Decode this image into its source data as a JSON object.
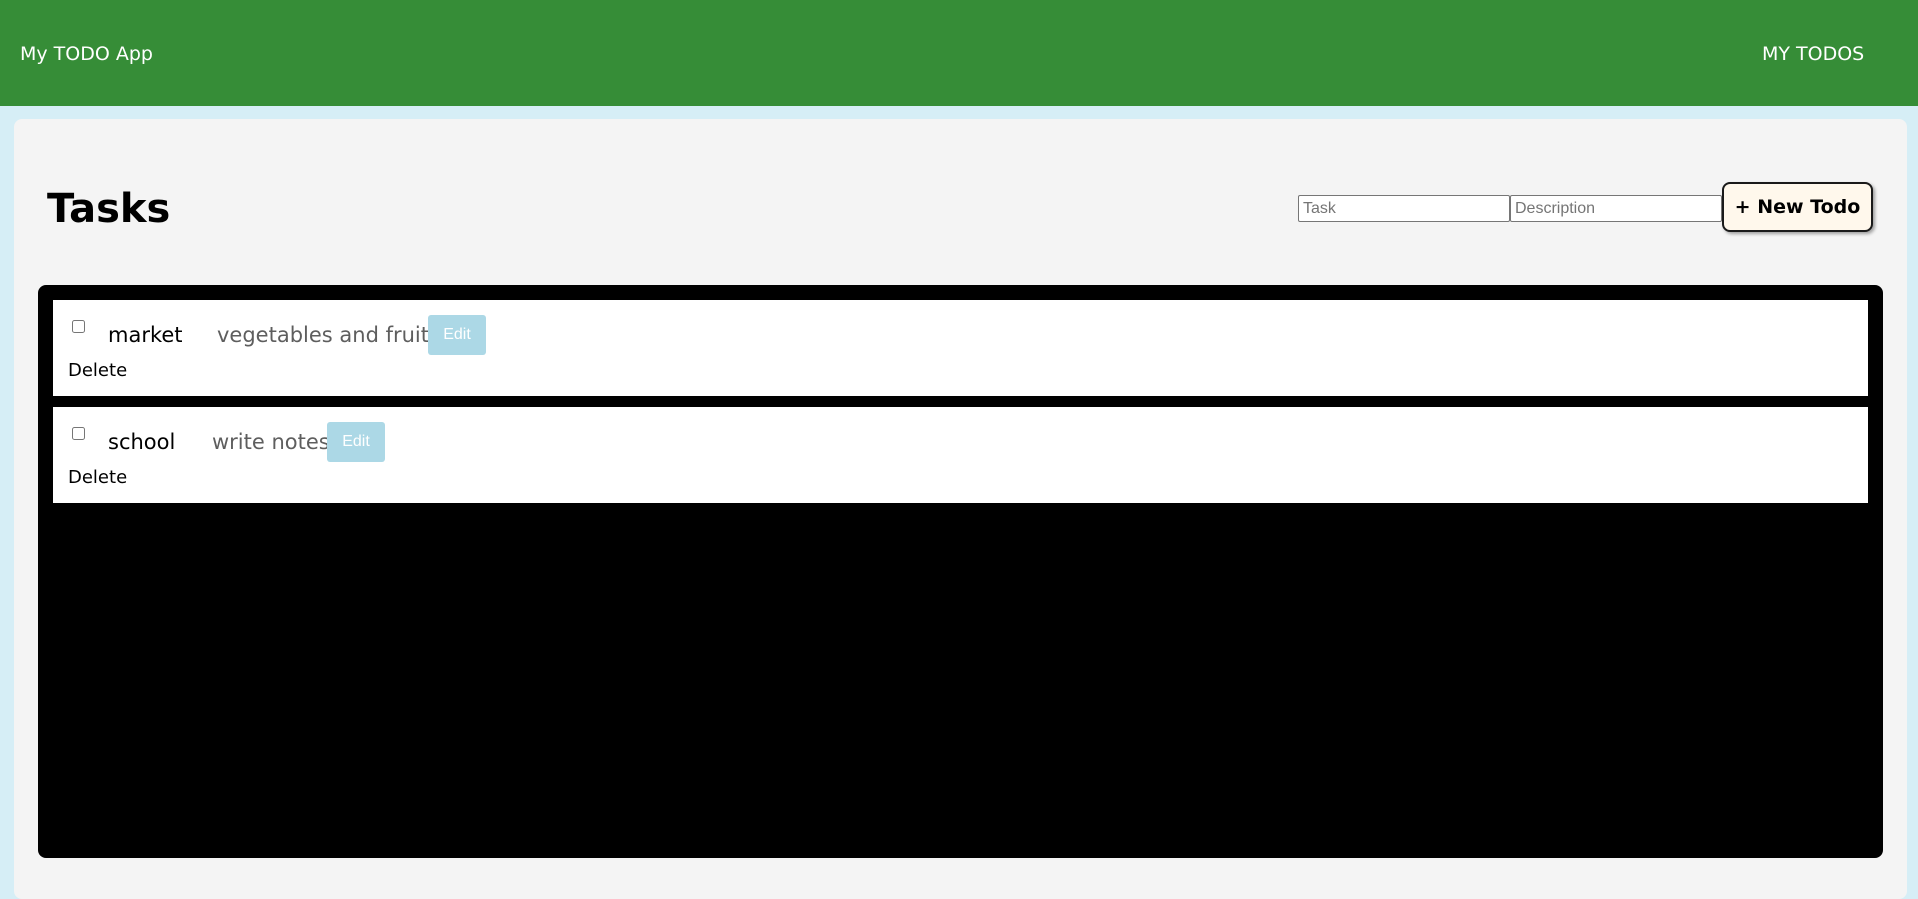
{
  "navbar": {
    "brand": "My TODO App",
    "link": "MY TODOS",
    "color": "#368d37"
  },
  "page": {
    "title": "Tasks"
  },
  "form": {
    "task_placeholder": "Task",
    "description_placeholder": "Description",
    "new_button": "+ New Todo"
  },
  "todos": [
    {
      "title": "market",
      "description": "vegetables and fruits",
      "edit_label": "Edit",
      "delete_label": "Delete",
      "checked": false
    },
    {
      "title": "school",
      "description": "write notes",
      "edit_label": "Edit",
      "delete_label": "Delete",
      "checked": false
    }
  ],
  "colors": {
    "edit_button": "#acd8e6",
    "list_background": "#000000",
    "page_background": "#d6eef6"
  }
}
